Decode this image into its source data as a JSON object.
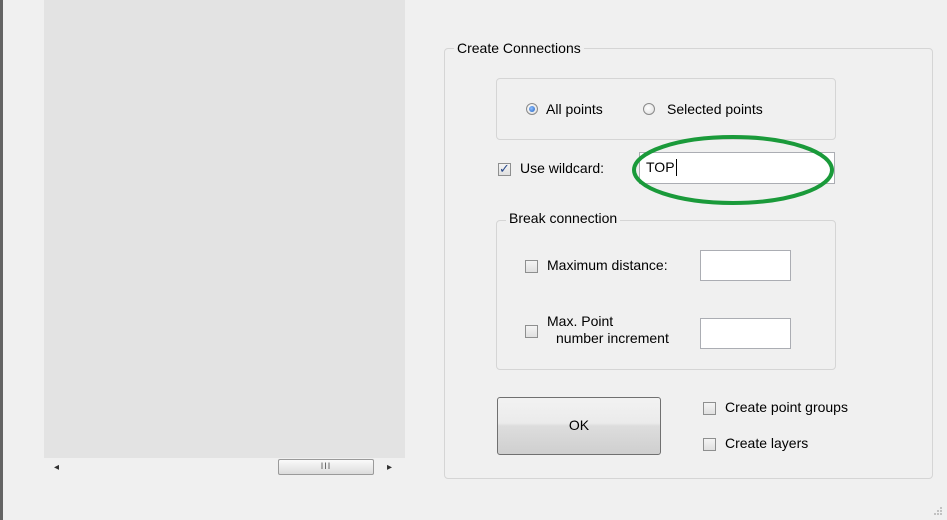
{
  "scrollbar": {
    "left_arrow": "◂",
    "right_arrow": "▸",
    "thumb_grip": "III"
  },
  "create_connections": {
    "title": "Create Connections",
    "point_selection": {
      "options": [
        {
          "label": "All points",
          "selected": true
        },
        {
          "label": "Selected points",
          "selected": false
        }
      ]
    },
    "wildcard": {
      "label": "Use wildcard:",
      "checked": true,
      "value": "TOP"
    },
    "break_connection": {
      "title": "Break connection",
      "max_distance": {
        "label": "Maximum distance:",
        "checked": false,
        "value": ""
      },
      "max_point_increment": {
        "label_line1": "Max. Point",
        "label_line2": "number increment",
        "checked": false,
        "value": ""
      }
    },
    "ok_button": "OK",
    "create_point_groups": {
      "label": "Create point groups",
      "checked": false
    },
    "create_layers": {
      "label": "Create layers",
      "checked": false
    }
  },
  "colors": {
    "highlight": "#1a9a3a",
    "panel": "#e3e3e3",
    "window": "#f0f0f0"
  }
}
